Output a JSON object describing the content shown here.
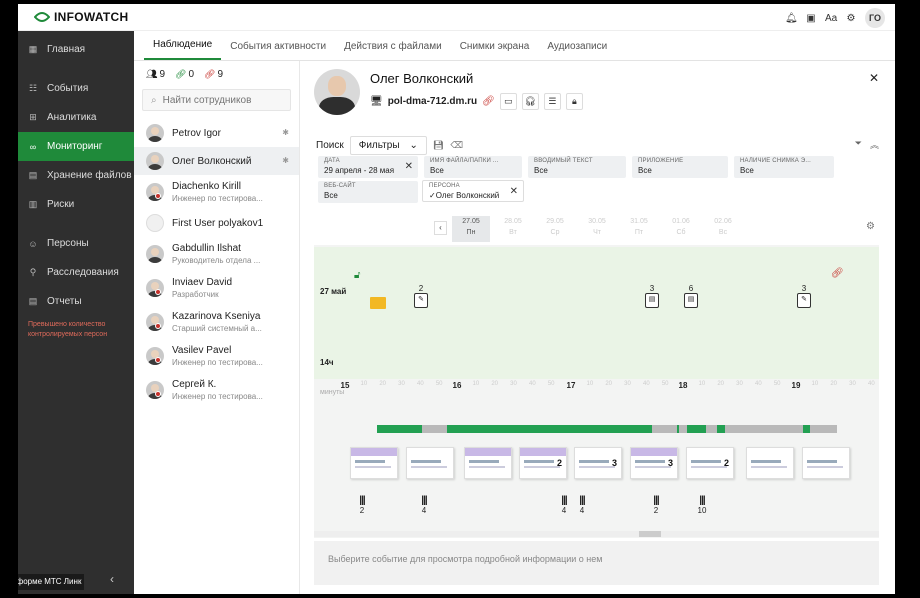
{
  "topbar": {
    "logo_text": "INFOWATCH",
    "avatar_initials": "ГО",
    "icons": [
      "bell-icon",
      "box-icon",
      "font-icon",
      "gear-icon"
    ]
  },
  "sidebar": {
    "items": [
      {
        "label": "Главная",
        "icon": "home-icon",
        "active": false
      },
      {
        "label": "События",
        "icon": "events-icon",
        "active": false
      },
      {
        "label": "Аналитика",
        "icon": "chart-icon",
        "active": false
      },
      {
        "label": "Мониторинг",
        "icon": "binoculars-icon",
        "active": true
      },
      {
        "label": "Хранение файлов",
        "icon": "storage-icon",
        "active": false
      },
      {
        "label": "Риски",
        "icon": "risk-icon",
        "active": false
      },
      {
        "label": "Персоны",
        "icon": "persons-icon",
        "active": false
      },
      {
        "label": "Расследования",
        "icon": "investigation-icon",
        "active": false
      },
      {
        "label": "Отчеты",
        "icon": "reports-icon",
        "active": false
      }
    ],
    "warning": "Превышено количество контролируемых персон",
    "bottom_label": "латформе МТС Линк"
  },
  "tabs": [
    "Наблюдение",
    "События активности",
    "Действия с файлами",
    "Снимки экрана",
    "Аудиозаписи"
  ],
  "people_panel": {
    "counts": [
      "9",
      "0",
      "9"
    ],
    "search_placeholder": "Найти сотрудников",
    "people": [
      {
        "name": "Petrov Igor",
        "role": "",
        "pinned": true,
        "selected": false
      },
      {
        "name": "Олег Волконский",
        "role": "",
        "pinned": true,
        "selected": true
      },
      {
        "name": "Diachenko Kirill",
        "role": "Инженер по тестирова...",
        "pinned": false,
        "selected": false
      },
      {
        "name": "First User polyakov1",
        "role": "",
        "pinned": false,
        "selected": false
      },
      {
        "name": "Gabdullin Ilshat",
        "role": "Руководитель отдела ...",
        "pinned": false,
        "selected": false
      },
      {
        "name": "Inviaev David",
        "role": "Разработчик",
        "pinned": false,
        "selected": false
      },
      {
        "name": "Kazarinova Kseniya",
        "role": "Старший системный а...",
        "pinned": false,
        "selected": false
      },
      {
        "name": "Vasilev Pavel",
        "role": "Инженер по тестирова...",
        "pinned": false,
        "selected": false
      },
      {
        "name": "Сергей К.",
        "role": "Инженер по тестирова...",
        "pinned": false,
        "selected": false
      }
    ]
  },
  "detail": {
    "person_name": "Олег Волконский",
    "host": "pol-dma-712.dm.ru",
    "search_label": "Поиск",
    "filter_select": "Фильтры",
    "filters": [
      {
        "label": "ДАТА",
        "value": "29 апреля - 28 мая"
      },
      {
        "label": "ИМЯ ФАЙЛА/ПАПКИ ...",
        "value": "Все"
      },
      {
        "label": "ВВОДИМЫЙ ТЕКСТ",
        "value": "Все"
      },
      {
        "label": "ПРИЛОЖЕНИЕ",
        "value": "Все"
      },
      {
        "label": "НАЛИЧИЕ СНИМКА Э...",
        "value": "Все"
      },
      {
        "label": "ВЕБ-САЙТ",
        "value": "Все"
      },
      {
        "label": "ПЕРСОНА",
        "value": "✓Олег Волконский"
      }
    ],
    "timeline": {
      "dates": [
        {
          "d": "27.05",
          "w": "Пн",
          "active": true
        },
        {
          "d": "28.05",
          "w": "Вт",
          "active": false
        },
        {
          "d": "29.05",
          "w": "Ср",
          "active": false
        },
        {
          "d": "30.05",
          "w": "Чт",
          "active": false
        },
        {
          "d": "31.05",
          "w": "Пт",
          "active": false
        },
        {
          "d": "01.06",
          "w": "Сб",
          "active": false
        },
        {
          "d": "02.06",
          "w": "Вс",
          "active": false
        }
      ],
      "day_label": "27 май",
      "hour_label": "14ч",
      "minutes_label": "минуты",
      "hours": [
        "15",
        "16",
        "17",
        "18",
        "19"
      ],
      "minute_ticks": [
        "10",
        "20",
        "30",
        "40",
        "50",
        "10",
        "20",
        "30",
        "40",
        "50",
        "10",
        "20",
        "30",
        "40",
        "50",
        "10",
        "20",
        "30",
        "40",
        "50",
        "10",
        "20",
        "30",
        "40",
        "50"
      ],
      "events": [
        {
          "count": "2",
          "icon": "edit-icon"
        },
        {
          "count": "3",
          "icon": "doc-icon"
        },
        {
          "count": "6",
          "icon": "doc-icon"
        },
        {
          "count": "3",
          "icon": "edit-icon"
        }
      ],
      "thumb_counts": [
        "",
        "",
        "",
        "2",
        "3",
        "3",
        "2",
        "",
        ""
      ],
      "keyboard_counts": [
        "2",
        "4",
        "4",
        "4",
        "2",
        "10"
      ]
    },
    "info_message": "Выберите событие для просмотра подробной информации о нем"
  },
  "colors": {
    "accent": "#1f8a3a",
    "sidebar_bg": "#2f2f2f",
    "activity_green": "#22a052",
    "warning": "#e06b5b"
  }
}
